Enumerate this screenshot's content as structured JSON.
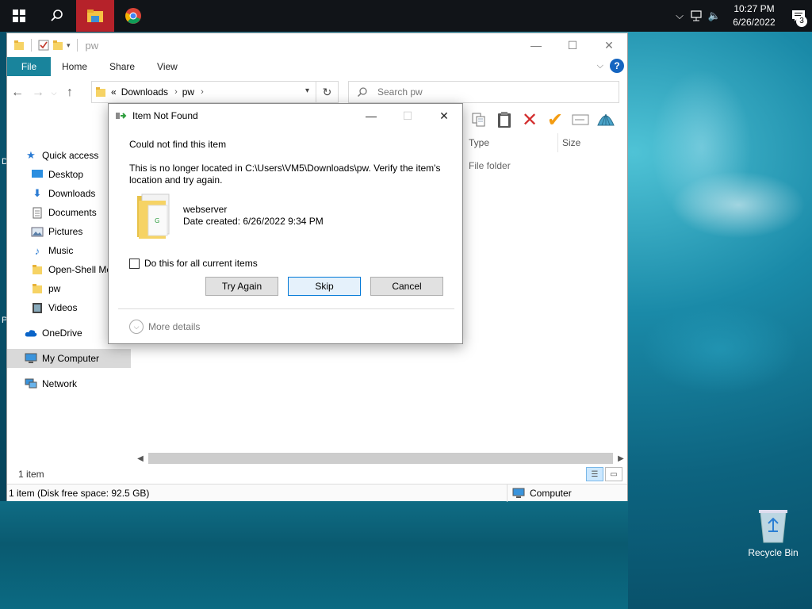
{
  "taskbar": {
    "time": "10:27 PM",
    "date": "6/26/2022",
    "notification_count": "3"
  },
  "explorer": {
    "title": "pw",
    "ribbon_tabs": [
      "File",
      "Home",
      "Share",
      "View"
    ],
    "address": {
      "prefix": "«",
      "crumbs": [
        "Downloads",
        "pw"
      ]
    },
    "search_placeholder": "Search pw",
    "nav": {
      "quick_access": "Quick access",
      "items": [
        "Desktop",
        "Downloads",
        "Documents",
        "Pictures",
        "Music",
        "Open-Shell Me",
        "pw",
        "Videos"
      ],
      "onedrive": "OneDrive",
      "my_computer": "My Computer",
      "network": "Network"
    },
    "columns": {
      "type": "Type",
      "size": "Size"
    },
    "row_type": "File folder",
    "status_items": "1 item",
    "bottom_status": "1 item (Disk free space: 92.5 GB)",
    "bottom_computer": "Computer"
  },
  "dialog": {
    "title": "Item Not Found",
    "heading": "Could not find this item",
    "message": "This is no longer located in C:\\Users\\VM5\\Downloads\\pw. Verify the item's location and try again.",
    "file_name": "webserver",
    "file_date": "Date created: 6/26/2022 9:34 PM",
    "checkbox_label": "Do this for all current items",
    "buttons": {
      "try_again": "Try Again",
      "skip": "Skip",
      "cancel": "Cancel"
    },
    "more_details": "More details"
  },
  "desktop": {
    "recycle_bin": "Recycle Bin",
    "edge_labels": [
      "D",
      "P"
    ]
  },
  "colors": {
    "accent": "#19849c",
    "taskbar": "#111418",
    "active_taskbar": "#b6222a",
    "delete_red": "#d32f2f",
    "check_orange": "#f39c12"
  }
}
